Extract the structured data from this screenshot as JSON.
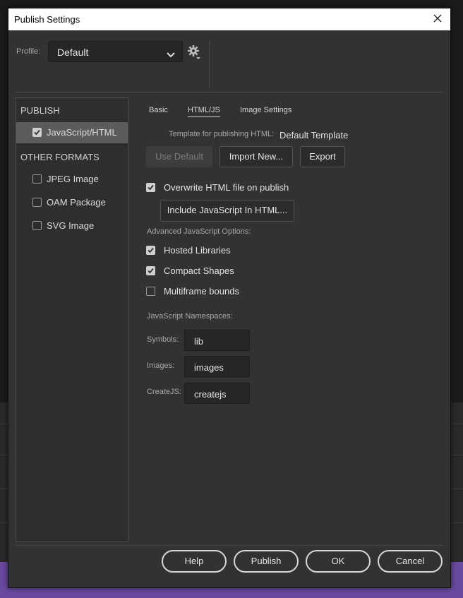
{
  "window": {
    "title": "Publish Settings"
  },
  "profile": {
    "label": "Profile:",
    "value": "Default"
  },
  "left_panel": {
    "publish_header": "PUBLISH",
    "publish_items": [
      {
        "label": "JavaScript/HTML",
        "checked": true,
        "selected": true
      }
    ],
    "other_header": "OTHER FORMATS",
    "other_items": [
      {
        "label": "JPEG Image",
        "checked": false
      },
      {
        "label": "OAM Package",
        "checked": false
      },
      {
        "label": "SVG Image",
        "checked": false
      }
    ]
  },
  "tabs": [
    {
      "label": "Basic",
      "active": false
    },
    {
      "label": "HTML/JS",
      "active": true
    },
    {
      "label": "Image Settings",
      "active": false
    }
  ],
  "template": {
    "label": "Template for publishing HTML:",
    "value": "Default Template",
    "use_default": "Use Default",
    "import_new": "Import New...",
    "export": "Export"
  },
  "overwrite": {
    "label": "Overwrite HTML file on publish",
    "checked": true
  },
  "include_js_button": "Include JavaScript In HTML...",
  "advanced": {
    "header": "Advanced JavaScript Options:",
    "options": [
      {
        "label": "Hosted Libraries",
        "checked": true
      },
      {
        "label": "Compact Shapes",
        "checked": true
      },
      {
        "label": "Multiframe bounds",
        "checked": false
      }
    ]
  },
  "namespaces": {
    "header": "JavaScript Namespaces:",
    "fields": [
      {
        "label": "Symbols:",
        "value": "lib"
      },
      {
        "label": "Images:",
        "value": "images"
      },
      {
        "label": "CreateJS:",
        "value": "createjs"
      }
    ]
  },
  "footer": {
    "help": "Help",
    "publish": "Publish",
    "ok": "OK",
    "cancel": "Cancel"
  },
  "colors": {
    "dialog_bg": "#323232",
    "selected_item": "#5b5b5b",
    "bottom_strip": "#6a4aa0"
  }
}
